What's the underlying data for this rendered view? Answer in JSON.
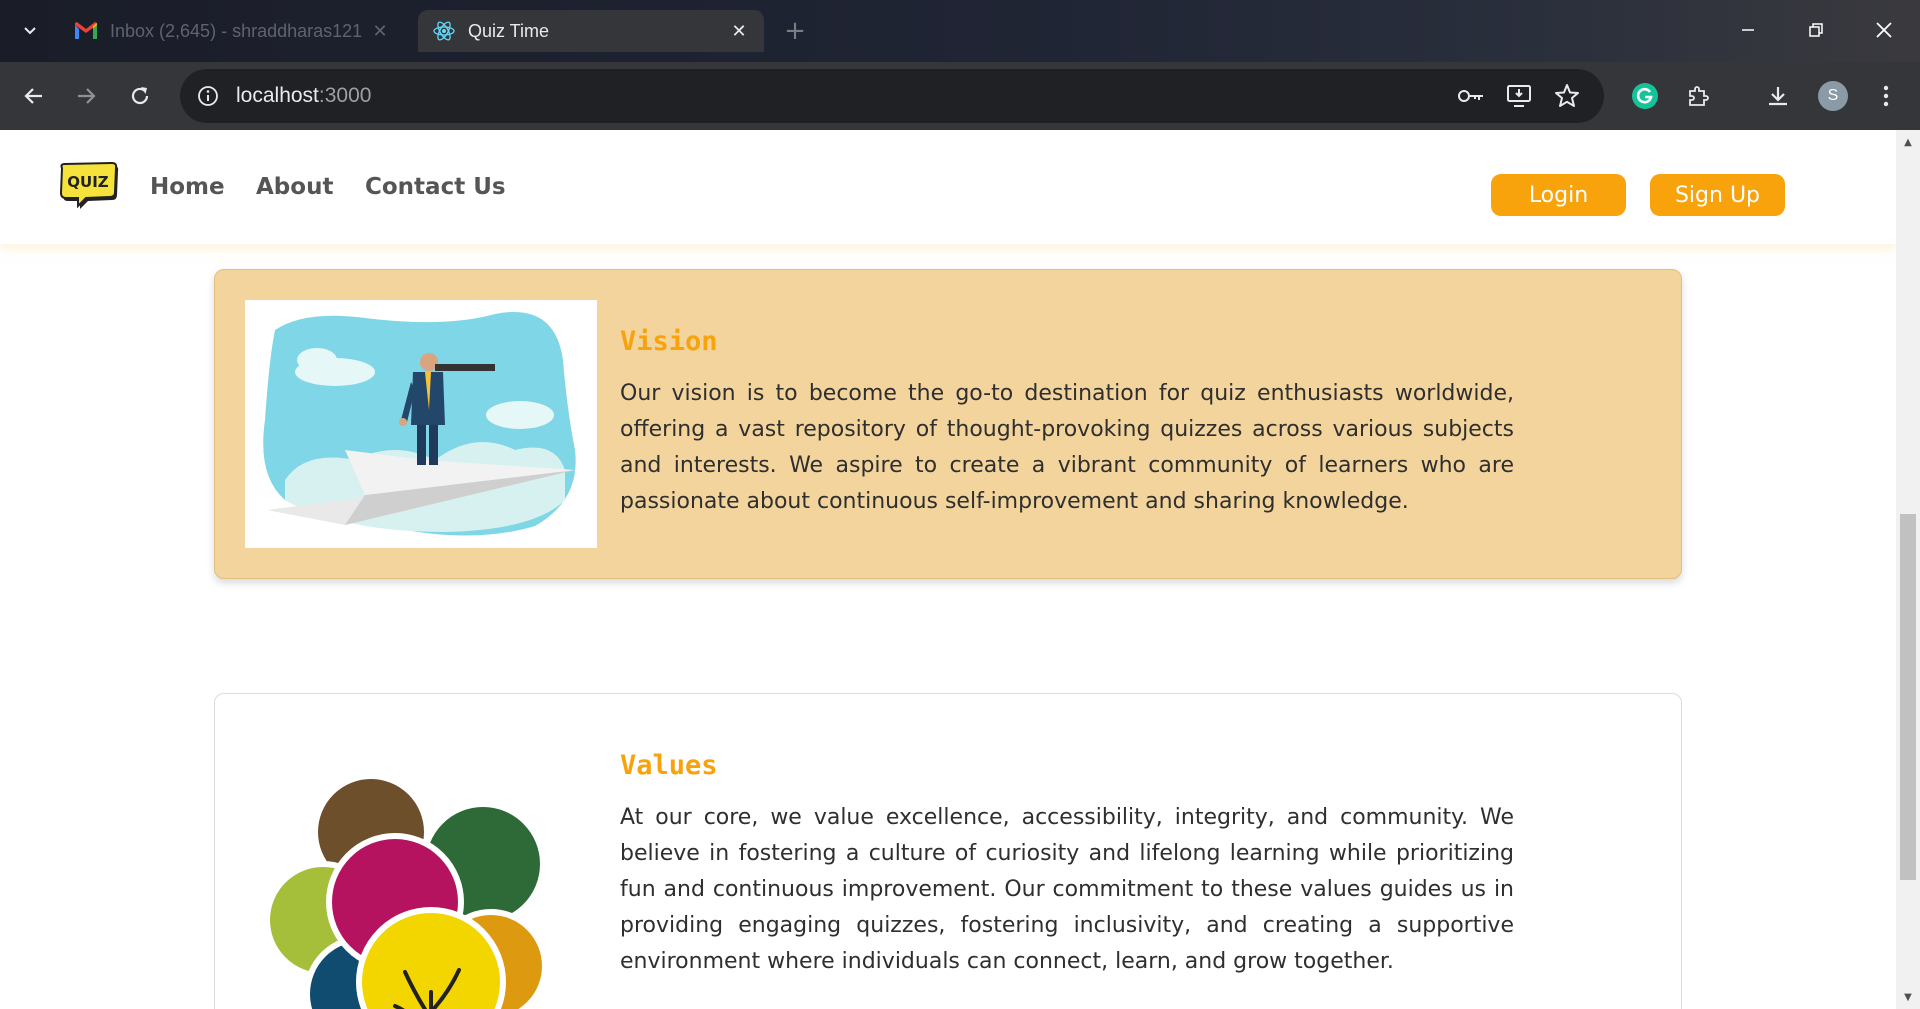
{
  "browser": {
    "tabs": [
      {
        "title": "Inbox (2,645) - shraddharas121",
        "active": false,
        "icon": "gmail-icon"
      },
      {
        "title": "Quiz Time",
        "active": true,
        "icon": "react-icon"
      }
    ],
    "url_host": "localhost",
    "url_port": ":3000",
    "profile_initial": "S"
  },
  "nav": {
    "logo_text": "QUIZ",
    "links": [
      "Home",
      "About",
      "Contact Us"
    ],
    "login_label": "Login",
    "signup_label": "Sign Up"
  },
  "cards": [
    {
      "title": "Vision",
      "text": "Our vision is to become the go-to destination for quiz enthusiasts worldwide, offering a vast repository of thought-provoking quizzes across various subjects and interests. We aspire to create a vibrant community of learners who are passionate about continuous self-improvement and sharing knowledge."
    },
    {
      "title": "Values",
      "text": "At our core, we value excellence, accessibility, integrity, and community. We believe in fostering a culture of curiosity and lifelong learning while prioritizing fun and continuous improvement. Our commitment to these values guides us in providing engaging quizzes, fostering inclusivity, and creating a supportive environment where individuals can connect, learn, and grow together."
    }
  ],
  "colors": {
    "accent": "#f9a30c",
    "vision_card_bg": "#f2d49c",
    "nav_text": "#555555"
  }
}
